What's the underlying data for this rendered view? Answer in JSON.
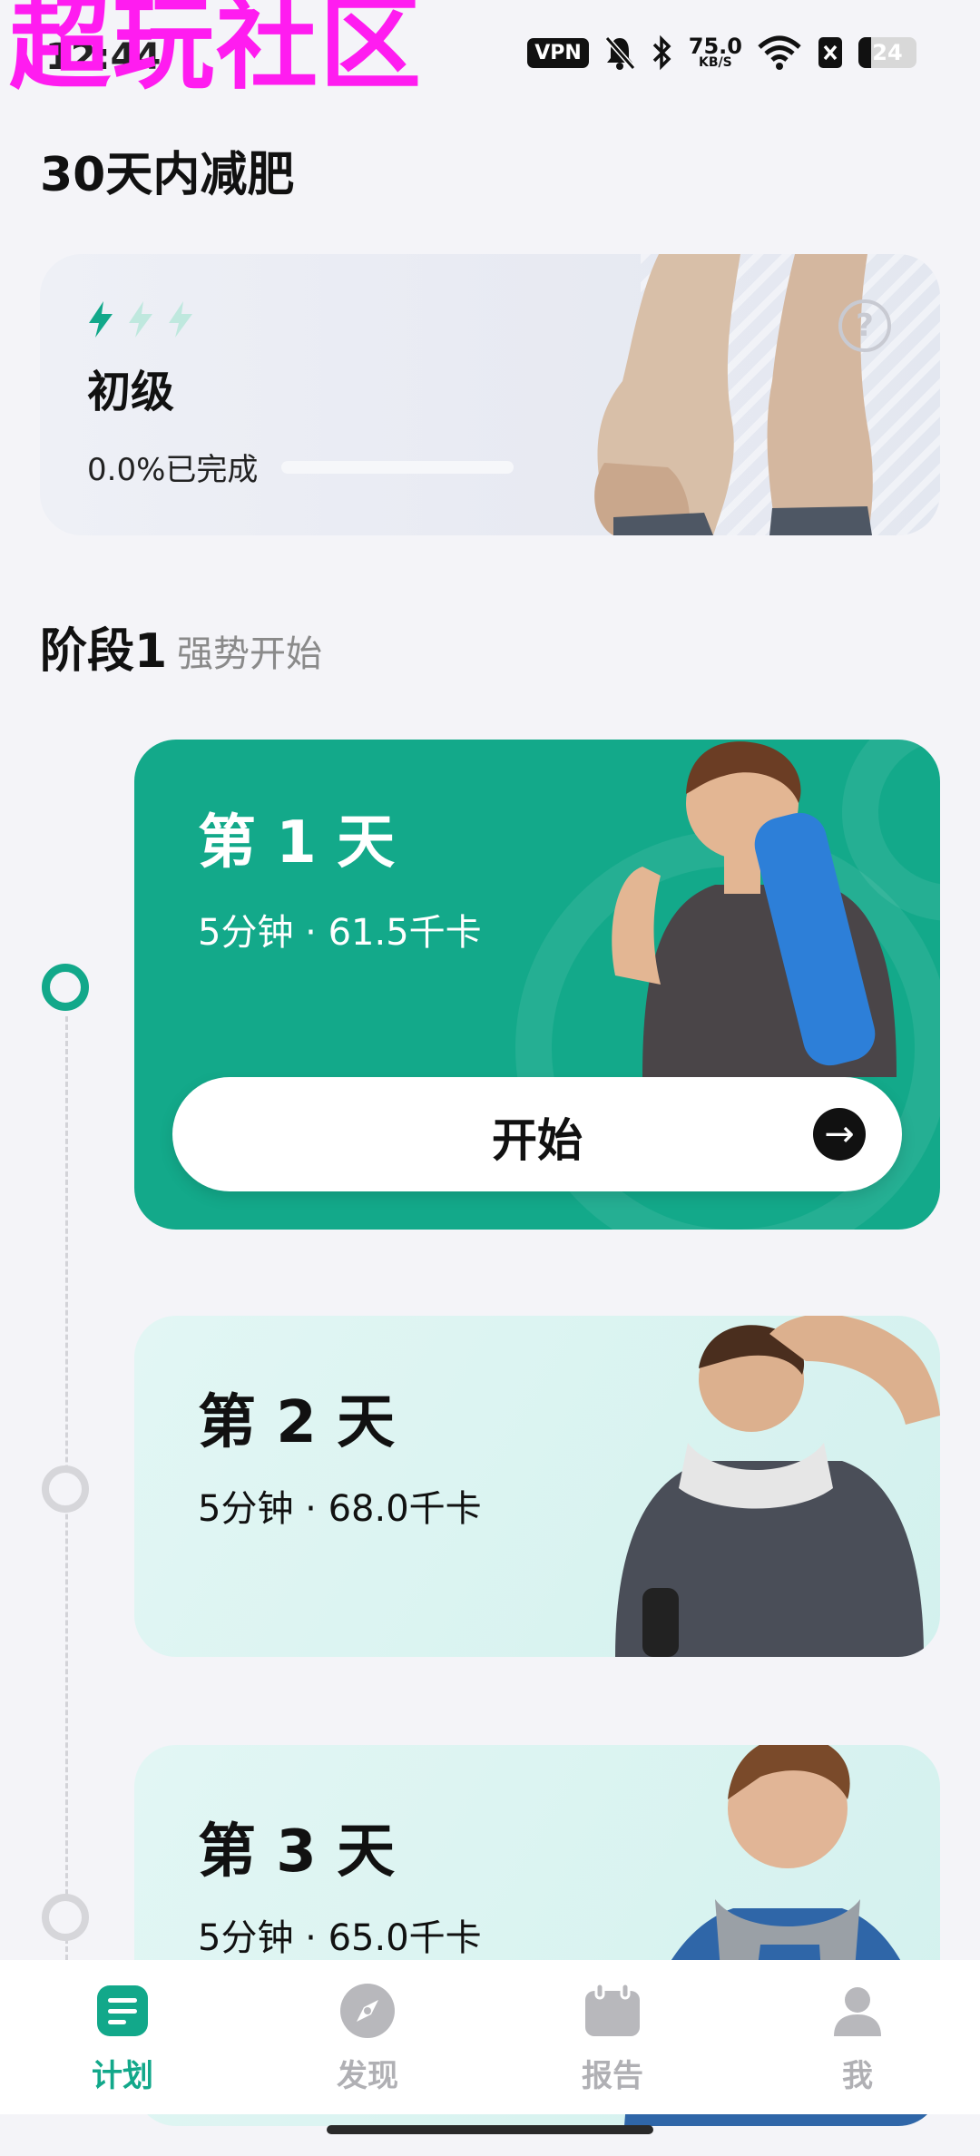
{
  "status_bar": {
    "watermark": "超玩社区",
    "clock": "12:44",
    "vpn": "VPN",
    "speed_value": "75.0",
    "speed_unit": "KB/S",
    "battery": "24"
  },
  "page": {
    "title": "30天内减肥"
  },
  "level_card": {
    "level": "初级",
    "progress_text": "0.0%已完成",
    "progress_fraction": 0.0,
    "bolt_color": "#12a88a",
    "help_icon": "question-circle-icon"
  },
  "stage": {
    "title": "阶段1",
    "subtitle": "强势开始"
  },
  "days": [
    {
      "title": "第 1 天",
      "meta": "5分钟 · 61.5千卡",
      "start_label": "开始"
    },
    {
      "title": "第 2 天",
      "meta": "5分钟 · 68.0千卡"
    },
    {
      "title": "第 3 天",
      "meta": "5分钟 · 65.0千卡"
    }
  ],
  "nav": [
    {
      "label": "计划",
      "icon": "plan-list-icon",
      "active": true
    },
    {
      "label": "发现",
      "icon": "compass-icon",
      "active": false
    },
    {
      "label": "报告",
      "icon": "calendar-report-icon",
      "active": false
    },
    {
      "label": "我",
      "icon": "profile-icon",
      "active": false
    }
  ],
  "colors": {
    "accent": "#12a88a",
    "page_bg": "#f4f4f8"
  }
}
